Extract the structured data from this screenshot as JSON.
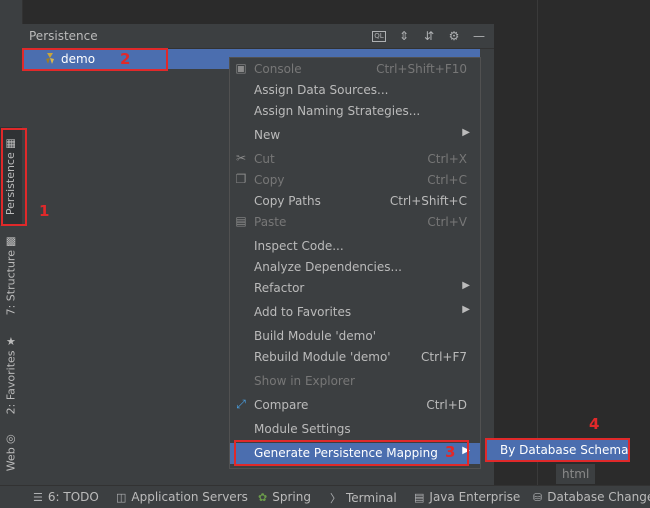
{
  "left_strip": {
    "tabs": [
      {
        "label": "Persistence",
        "icon": "persistence-icon"
      },
      {
        "label": "7: Structure",
        "icon": "structure-icon"
      },
      {
        "label": "2: Favorites",
        "icon": "star-icon"
      },
      {
        "label": "Web",
        "icon": "globe-icon"
      }
    ]
  },
  "panel": {
    "title": "Persistence",
    "tools": [
      "ql-icon",
      "expand-all-icon",
      "collapse-all-icon",
      "gear-icon",
      "minimize-icon"
    ],
    "tree": [
      {
        "label": "demo",
        "icon": "hibernate-icon"
      }
    ]
  },
  "annotations": {
    "n1": "1",
    "n2": "2",
    "n3": "3",
    "n4": "4"
  },
  "menu": {
    "items": [
      {
        "label": "Console",
        "shortcut": "Ctrl+Shift+F10",
        "disabled": true,
        "icon": "console-icon"
      },
      {
        "label": "Assign Data Sources...",
        "shortcut": ""
      },
      {
        "label": "Assign Naming Strategies...",
        "shortcut": ""
      },
      {
        "label": "New",
        "shortcut": "",
        "submenu": true
      },
      {
        "label": "Cut",
        "shortcut": "Ctrl+X",
        "disabled": true,
        "icon": "cut-icon"
      },
      {
        "label": "Copy",
        "shortcut": "Ctrl+C",
        "disabled": true,
        "icon": "copy-icon"
      },
      {
        "label": "Copy Paths",
        "shortcut": "Ctrl+Shift+C"
      },
      {
        "label": "Paste",
        "shortcut": "Ctrl+V",
        "disabled": true,
        "icon": "paste-icon"
      },
      {
        "label": "Inspect Code...",
        "shortcut": ""
      },
      {
        "label": "Analyze Dependencies...",
        "shortcut": ""
      },
      {
        "label": "Refactor",
        "shortcut": "",
        "submenu": true
      },
      {
        "label": "Add to Favorites",
        "shortcut": "",
        "submenu": true
      },
      {
        "label": "Build Module 'demo'",
        "shortcut": ""
      },
      {
        "label": "Rebuild Module 'demo'",
        "shortcut": "Ctrl+F7"
      },
      {
        "label": "Show in Explorer",
        "shortcut": "",
        "disabled": true
      },
      {
        "label": "Compare",
        "shortcut": "Ctrl+D",
        "icon": "compare-icon"
      },
      {
        "label": "Module Settings",
        "shortcut": ""
      },
      {
        "label": "Generate Persistence Mapping",
        "shortcut": "",
        "submenu": true,
        "highlight": true
      }
    ]
  },
  "submenu": {
    "label": "By Database Schema"
  },
  "hint": {
    "label": "html"
  },
  "bottom_bar": {
    "items": [
      {
        "label": "6: TODO",
        "icon": "list-icon"
      },
      {
        "label": "Application Servers",
        "icon": "server-icon"
      },
      {
        "label": "Spring",
        "icon": "spring-icon"
      },
      {
        "label": "Terminal",
        "icon": "terminal-icon"
      },
      {
        "label": "Java Enterprise",
        "icon": "java-enterprise-icon"
      },
      {
        "label": "Database Changes",
        "icon": "database-icon"
      }
    ]
  },
  "colors": {
    "accent": "#4b6eaf",
    "annotation": "#e0292a",
    "background": "#2b2b2b",
    "panel": "#3c3f41"
  }
}
